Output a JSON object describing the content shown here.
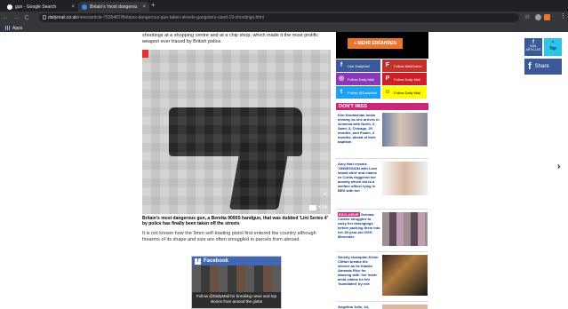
{
  "browser": {
    "tabs": [
      {
        "title": "gun - Google Search",
        "favicon_color": "#ffffff"
      },
      {
        "title": "Britain's 'most dangerou",
        "favicon_color": "#4285f4"
      }
    ],
    "url_host": "dailymail.co.uk",
    "url_path": "/news/article-7536487/Britains-dangerous-gun-taken-streets-gangsters-used-19-shootings.html",
    "bookmark_apps": "Apps"
  },
  "article": {
    "lead_text": "shootings at a shopping centre and at a chip shop, which made it the most prolific weapon ever traced by British police.",
    "photo_count": "+14",
    "caption": "Britain's most dangerous gun, a Beretta 9000S handgun, that was dubbed 'Lint Series 4' by police has finally been taken off the streets",
    "body": "It is not known how the 9mm self-loading pistol first entered the country although firearms of its shape and size are often smuggled in parcels from abroad."
  },
  "fb_ad": {
    "header": "Facebook",
    "text": "Follow @DailyMail for breaking news and top stories from around the globe"
  },
  "sidebar": {
    "more_button": "+ MEHR ERFAHREN",
    "socials": [
      {
        "icon": "f",
        "label": "Like DailyMail",
        "color": "#3b5998"
      },
      {
        "icon": "F",
        "label": "Follow MailOnline",
        "color": "#c4302b"
      },
      {
        "icon": "◎",
        "label": "Follow Daily Mail",
        "color": "#8a3ab9"
      },
      {
        "icon": "P",
        "label": "Follow Daily Mail",
        "color": "#cb2027"
      },
      {
        "icon": "t",
        "label": "Follow @DailyMail",
        "color": "#1da1f2"
      },
      {
        "icon": "☺",
        "label": "Follow Daily Mail",
        "color": "#fffc00"
      }
    ],
    "dont_miss": "DON'T MISS",
    "items": [
      {
        "text": "Kim Kardashian looks dreamy as she arrives in Armenia with North, 6, Saint, 3, Chicago, 20 months, and Psalm, 4 months, ahead of their baptism",
        "exclusive": ""
      },
      {
        "text": "Amy Hart reveals 'OBSESSION with Love Island stint' and claims ex Curtis triggered her anxiety which led to a welfare officer lying in BED with her",
        "exclusive": ""
      },
      {
        "text": "Gemma Collins struggles to carry her belongings before packing them into her 39-year-old GSH Mercedes",
        "exclusive": "EXCLUSIVE"
      },
      {
        "text": "Strictly champion Kevin Clifton breaks his silence as he thanks Amanda Rice for dancing with 'her heart' amid claims he felt 'humiliated' by exit",
        "exclusive": ""
      },
      {
        "text": "Angelina Jolie, 44,",
        "exclusive": ""
      }
    ]
  },
  "right_rail": {
    "fb_label": "MAIL ARTICLES",
    "top_label": "Top",
    "share_label": "Share"
  }
}
